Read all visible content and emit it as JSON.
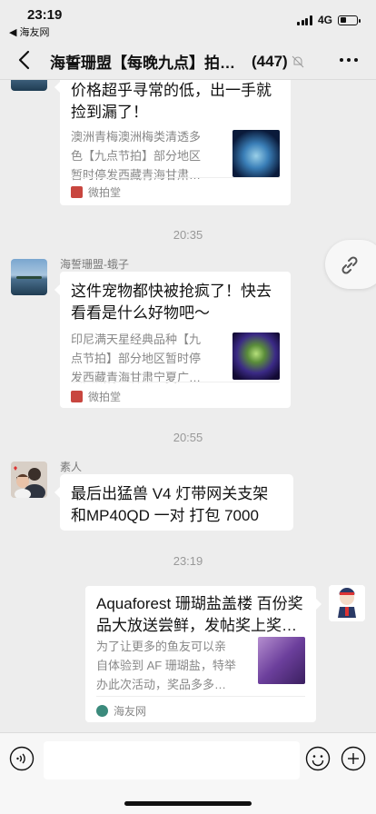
{
  "status": {
    "time": "23:19",
    "back_app": "◀ 海友网",
    "network": "4G"
  },
  "navbar": {
    "title": "海誓珊盟【每晚九点】拍卖群",
    "count": "(447)"
  },
  "messages": [
    {
      "type": "card",
      "title": "价格超乎寻常的低，出一手就捡到漏了！",
      "desc": [
        "澳洲青梅澳洲梅类清透多",
        "色【九点节拍】部分地区",
        "暂时停发西藏青海甘肃…"
      ],
      "source": "微拍堂"
    },
    {
      "type": "time",
      "text": "20:35"
    },
    {
      "type": "card",
      "sender": "海誓珊盟-蛾子",
      "title": "这件宠物都快被抢疯了！快去看看是什么好物吧～",
      "desc": [
        "印尼满天星经典品种【九",
        "点节拍】部分地区暂时停",
        "发西藏青海甘肃宁夏广…"
      ],
      "source": "微拍堂"
    },
    {
      "type": "time",
      "text": "20:55"
    },
    {
      "type": "text",
      "sender": "素人",
      "text": "最后出猛兽 V4 灯带网关支架和MP40QD 一对 打包 7000"
    },
    {
      "type": "time",
      "text": "23:19"
    },
    {
      "type": "card",
      "title": "Aquaforest 珊瑚盐盖楼 百份奖品大放送尝鲜，发帖奖上奖…",
      "desc": [
        "为了让更多的鱼友可以亲",
        "自体验到 AF 珊瑚盐，特举",
        "办此次活动，奖品多多…"
      ],
      "source": "海友网"
    }
  ],
  "icons": {
    "back": "chevron-left-icon",
    "mute": "bell-off-icon",
    "more": "more-dots-icon",
    "link": "link-icon",
    "voice": "voice-icon",
    "emoji": "emoji-icon",
    "plus": "plus-icon"
  }
}
